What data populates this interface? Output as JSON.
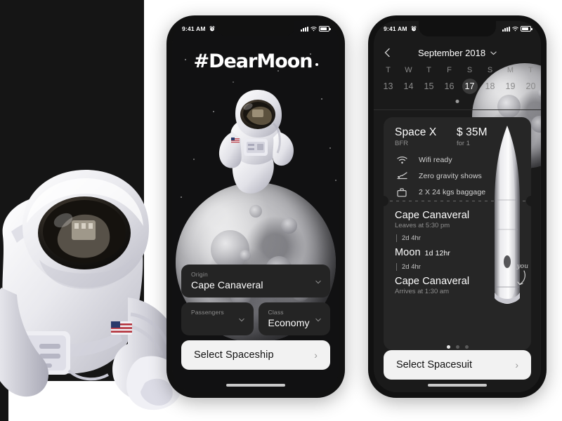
{
  "theme": {
    "bg": "#ffffff",
    "panel": "#151515",
    "card": "#262626",
    "accent": "#f2f2f2"
  },
  "status_bar": {
    "time": "9:41 AM",
    "alarm_icon": "alarm-clock-icon",
    "signal_icon": "cellular-signal-icon",
    "wifi_icon": "wifi-icon",
    "battery_icon": "battery-icon"
  },
  "phone_mid": {
    "title": "#DearMoon",
    "hero_astronaut_alt": "astronaut-floating",
    "moon_alt": "moon-large",
    "fields": [
      {
        "label": "Origin",
        "value": "Cape Canaveral",
        "name": "origin"
      },
      {
        "label": "Passengers",
        "value": "",
        "name": "passengers"
      },
      {
        "label": "Class",
        "value": "Economy",
        "name": "class"
      }
    ],
    "cta": {
      "label": "Select Spaceship",
      "arrow": "›"
    }
  },
  "phone_right": {
    "calendar": {
      "back_icon": "chevron-left-icon",
      "month": "September 2018",
      "month_chevron": "chevron-down-icon",
      "day_labels": [
        "T",
        "W",
        "T",
        "F",
        "S",
        "S",
        "M",
        "T"
      ],
      "dates": [
        "13",
        "14",
        "15",
        "16",
        "17",
        "18",
        "19",
        "20"
      ],
      "selected_index": 4
    },
    "ticket": {
      "brand": "Space X",
      "brand_sub": "BFR",
      "price": "$ 35M",
      "price_sub": "for 1",
      "amenities": [
        {
          "icon": "wifi-icon",
          "text": "Wifi ready"
        },
        {
          "icon": "reclining-seat-icon",
          "text": "Zero gravity shows"
        },
        {
          "icon": "briefcase-icon",
          "text": "2 X 24 kgs baggage"
        }
      ],
      "itinerary": [
        {
          "city": "Cape Canaveral",
          "sub": "Leaves at 5:30 pm",
          "duration": ""
        },
        {
          "leg": "2d 4hr"
        },
        {
          "city": "Moon",
          "sub": "",
          "duration": "1d 12hr"
        },
        {
          "leg": "2d 4hr"
        },
        {
          "city": "Cape Canaveral",
          "sub": "Arrives at 1:30 am",
          "duration": ""
        }
      ],
      "rocket_alt": "rocket-illustration",
      "you_annotation": "you"
    },
    "page_dots": {
      "count": 3,
      "active": 0
    },
    "cta": {
      "label": "Select Spacesuit",
      "arrow": "›"
    }
  }
}
